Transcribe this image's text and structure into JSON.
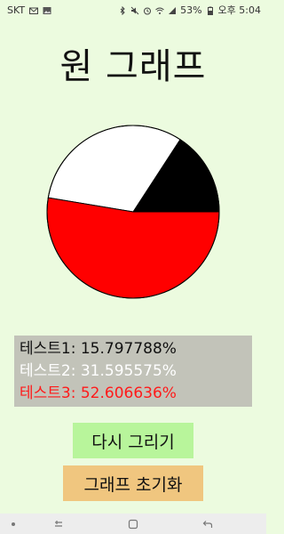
{
  "status_bar": {
    "carrier": "SKT",
    "battery": "53%",
    "time": "오후 5:04"
  },
  "title": "원 그래프",
  "colors": {
    "background": "#ecfbdf",
    "legend_bg": "#c2c3b9",
    "redraw_button": "#b8f59b",
    "reset_button": "#f0c67f",
    "nav_bar": "#ededed"
  },
  "chart_data": {
    "type": "pie",
    "start_angle_deg": 0,
    "direction": "counterclockwise",
    "slices": [
      {
        "label": "테스트1",
        "value": 15.797788,
        "color": "#000000"
      },
      {
        "label": "테스트2",
        "value": 31.595575,
        "color": "#ffffff"
      },
      {
        "label": "테스트3",
        "value": 52.606636,
        "color": "#ff0000"
      }
    ]
  },
  "legend": [
    {
      "text": "테스트1: 15.797788%",
      "color": "#111111"
    },
    {
      "text": "테스트2: 31.595575%",
      "color": "#ffffff"
    },
    {
      "text": "테스트3: 52.606636%",
      "color": "#ff1a1a"
    }
  ],
  "buttons": {
    "redraw": "다시 그리기",
    "reset": "그래프 초기화"
  },
  "nav_icons": [
    "dot-icon",
    "recent-apps-icon",
    "home-icon",
    "back-icon"
  ]
}
